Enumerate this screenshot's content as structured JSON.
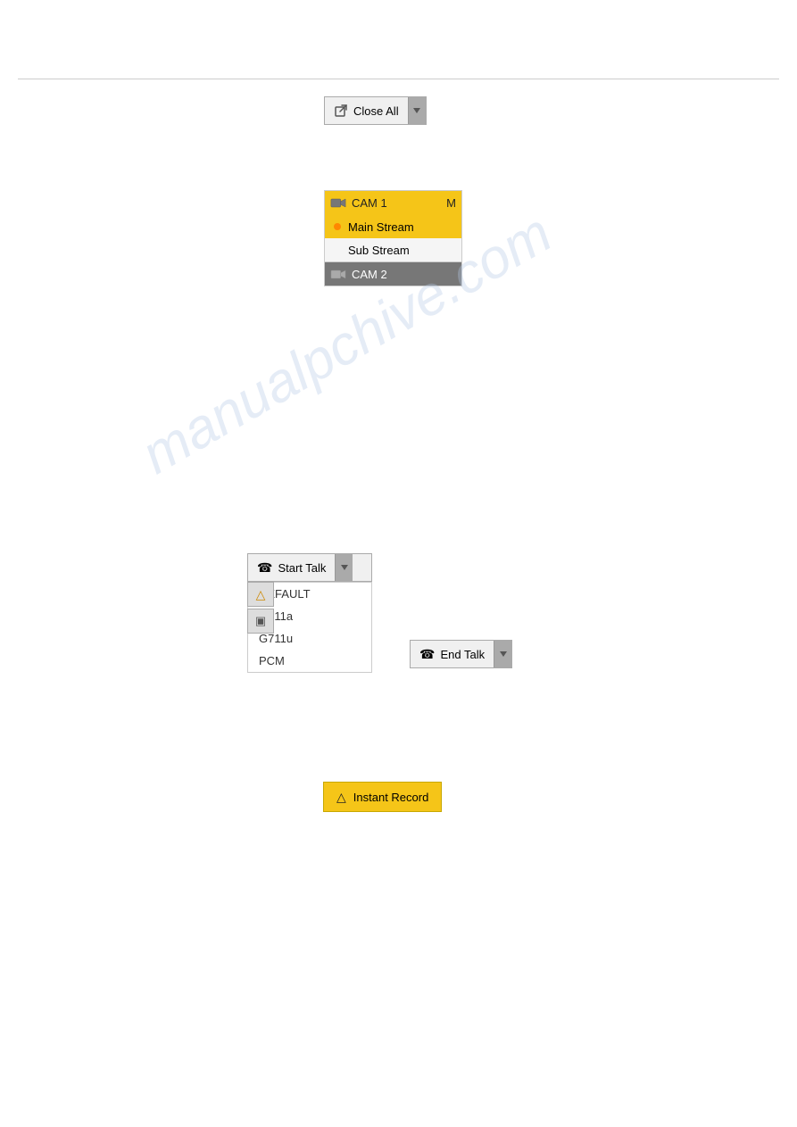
{
  "page": {
    "background": "#ffffff"
  },
  "watermark": {
    "text": "manualpchive.com"
  },
  "closeAll": {
    "label": "Close All",
    "dropdown_aria": "close-all-dropdown"
  },
  "camDropdown": {
    "cam1": {
      "label": "CAM 1",
      "suffix": "M",
      "mainStream": "Main Stream",
      "subStream": "Sub Stream"
    },
    "cam2": {
      "label": "CAM 2"
    }
  },
  "startTalk": {
    "label": "Start Talk",
    "menuItems": [
      "DEFAULT",
      "G711a",
      "G711u",
      "PCM"
    ]
  },
  "endTalk": {
    "label": "End Talk"
  },
  "instantRecord": {
    "label": "Instant Record"
  }
}
